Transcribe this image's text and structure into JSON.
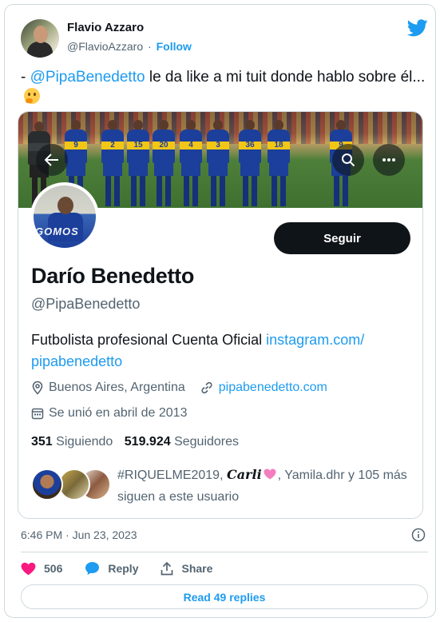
{
  "tweet": {
    "author_name": "Flavio Azzaro",
    "author_handle": "@FlavioAzzaro",
    "separator": "·",
    "follow_label": "Follow",
    "text_prefix": "- ",
    "text_mention": "@PipaBenedetto",
    "text_body": " le da like a mi tuit donde hablo sobre él...",
    "emoji": "thinking-face",
    "timestamp": "6:46 PM · Jun 23, 2023",
    "likes_count": "506",
    "reply_label": "Reply",
    "share_label": "Share",
    "read_replies_label": "Read 49 replies"
  },
  "profile": {
    "follow_button_label": "Seguir",
    "name": "Darío Benedetto",
    "handle": "@PipaBenedetto",
    "avatar_text": "GOMOS",
    "bio_text": "Futbolista profesional Cuenta Oficial ",
    "bio_link": "instagram.com/ pipabenedetto",
    "location": "Buenos Aires, Argentina",
    "website": "pipabenedetto.com",
    "joined": "Se unió en abril de 2013",
    "following_count": "351",
    "following_label": "Siguiendo",
    "followers_count": "519.924",
    "followers_label": "Seguidores",
    "followed_by_prefix": "#RIQUELME2019, ",
    "followed_by_carli": "Carli",
    "followed_by_suffix": ", Yamila.dhr y 105 más siguen a este usuario",
    "banner_numbers": [
      "9",
      "2",
      "15",
      "20",
      "4",
      "3",
      "36",
      "18",
      "9"
    ]
  },
  "colors": {
    "accent": "#1d9bf0",
    "text": "#0f1419",
    "muted": "#536471",
    "like": "#f91880",
    "border": "#cfd9de"
  }
}
